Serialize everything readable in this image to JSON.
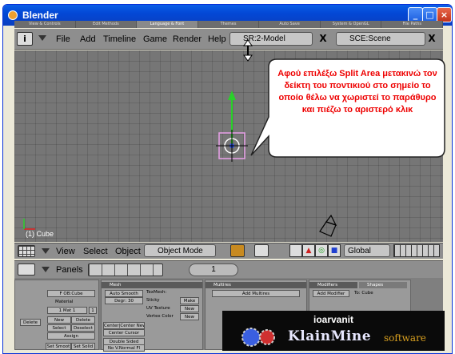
{
  "window": {
    "title": "Blender"
  },
  "infobar": {
    "items": [
      "View & Controls",
      "Edit Methods",
      "Language & Font",
      "Themes",
      "Auto Save",
      "System & OpenGL",
      "File Paths"
    ],
    "active_index": 2
  },
  "menubar": {
    "items": [
      "File",
      "Add",
      "Timeline",
      "Game",
      "Render",
      "Help"
    ],
    "screen_select": "SR:2-Model",
    "scene_select": "SCE:Scene",
    "close_label": "X"
  },
  "viewport": {
    "object_label": "(1) Cube"
  },
  "annotation": {
    "text": "Αφού επιλέξω Split Area μετακινώ τον δείκτη του ποντικιού στο σημείο το οποίο θέλω να χωριστεί το παράθυρο και πιέζω το αριστερό κλικ"
  },
  "view3d_header": {
    "menus": [
      "View",
      "Select",
      "Object"
    ],
    "mode_select": "Object Mode",
    "orientation_select": "Global"
  },
  "buttons_header": {
    "label": "Panels",
    "frame": "1"
  },
  "panels": {
    "link_panel": {
      "ob": "F OB:Cube",
      "material": "Material",
      "mat_index": "1 Mat 1",
      "mat_count": "1",
      "delete": "Delete",
      "new": "New",
      "delete2": "Delete",
      "select": "Select",
      "deselect": "Deselect",
      "assign": "Assign",
      "set_smooth": "Set Smoot",
      "set_solid": "Set Solid"
    },
    "mesh_panel": {
      "title": "Mesh",
      "auto_smooth": "Auto Smooth",
      "degr": "Degr: 30",
      "texmesh": "TexMesh:",
      "sticky": "Sticky",
      "make": "Make",
      "uv_texture": "UV Texture",
      "new1": "New",
      "vertex_color": "Vertex Color",
      "new2": "New",
      "center_new": "Center|Center New",
      "center_cursor": "Center Cursor",
      "double_sided": "Double Sided",
      "no_vnormal": "No V.Normal Fl"
    },
    "multires_panel": {
      "title": "Multires",
      "add_multires": "Add Multires"
    },
    "modifiers_panel": {
      "tab1": "Modifiers",
      "tab2": "Shapes",
      "add_modifier": "Add Modifier",
      "to": "To: Cube"
    }
  },
  "watermark": {
    "name": "ioarvanit",
    "brand": "KlainMine",
    "suffix": "software"
  },
  "colors": {
    "annotation_text": "#e00000",
    "viewport_bg": "#767676",
    "title_blue": "#0348d6"
  }
}
